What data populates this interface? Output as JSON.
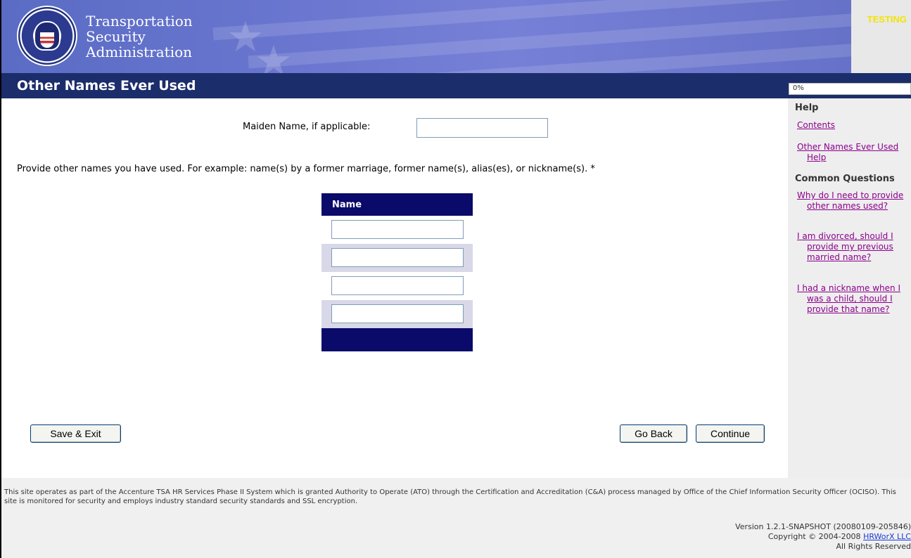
{
  "header": {
    "agency_line1": "Transportation",
    "agency_line2": "Security",
    "agency_line3": "Administration",
    "environment_badge": "TESTING"
  },
  "titlebar": {
    "title": "Other Names Ever Used",
    "progress_text": "0%"
  },
  "form": {
    "maiden_label": "Maiden Name, if applicable:",
    "maiden_value": "",
    "instructions": "Provide other names you have used. For example: name(s) by a former marriage, former name(s), alias(es), or nickname(s). *",
    "names_header": "Name",
    "name_values": [
      "",
      "",
      "",
      ""
    ]
  },
  "buttons": {
    "save_exit": "Save & Exit",
    "go_back": "Go Back",
    "continue": "Continue"
  },
  "sidebar": {
    "help_heading": "Help",
    "contents_link": "Contents",
    "topic_help_link": "Other Names Ever Used Help",
    "common_questions_heading": "Common Questions",
    "questions": [
      "Why do I need to provide other names used?",
      "I am divorced, should I provide my previous married name?",
      "I had a nickname when I was a child, should I provide that name?"
    ]
  },
  "footer": {
    "notice": "This site operates as part of the Accenture TSA HR Services Phase II System which is granted Authority to Operate (ATO) through the Certification and Accreditation (C&A) process managed by Office of the Chief Information Security Officer (OCISO). This site is monitored for security and employs industry standard security standards and SSL encryption.",
    "version": "Version 1.2.1-SNAPSHOT (20080109-205846)",
    "copyright_prefix": "Copyright © 2004-2008",
    "company_link": "HRWorX LLC",
    "rights": "All Rights Reserved"
  },
  "colors": {
    "title_bar": "#1c2d6b",
    "table_header": "#0a0a6a",
    "link_visited": "#8c008c",
    "testing_badge": "#f2e400"
  }
}
